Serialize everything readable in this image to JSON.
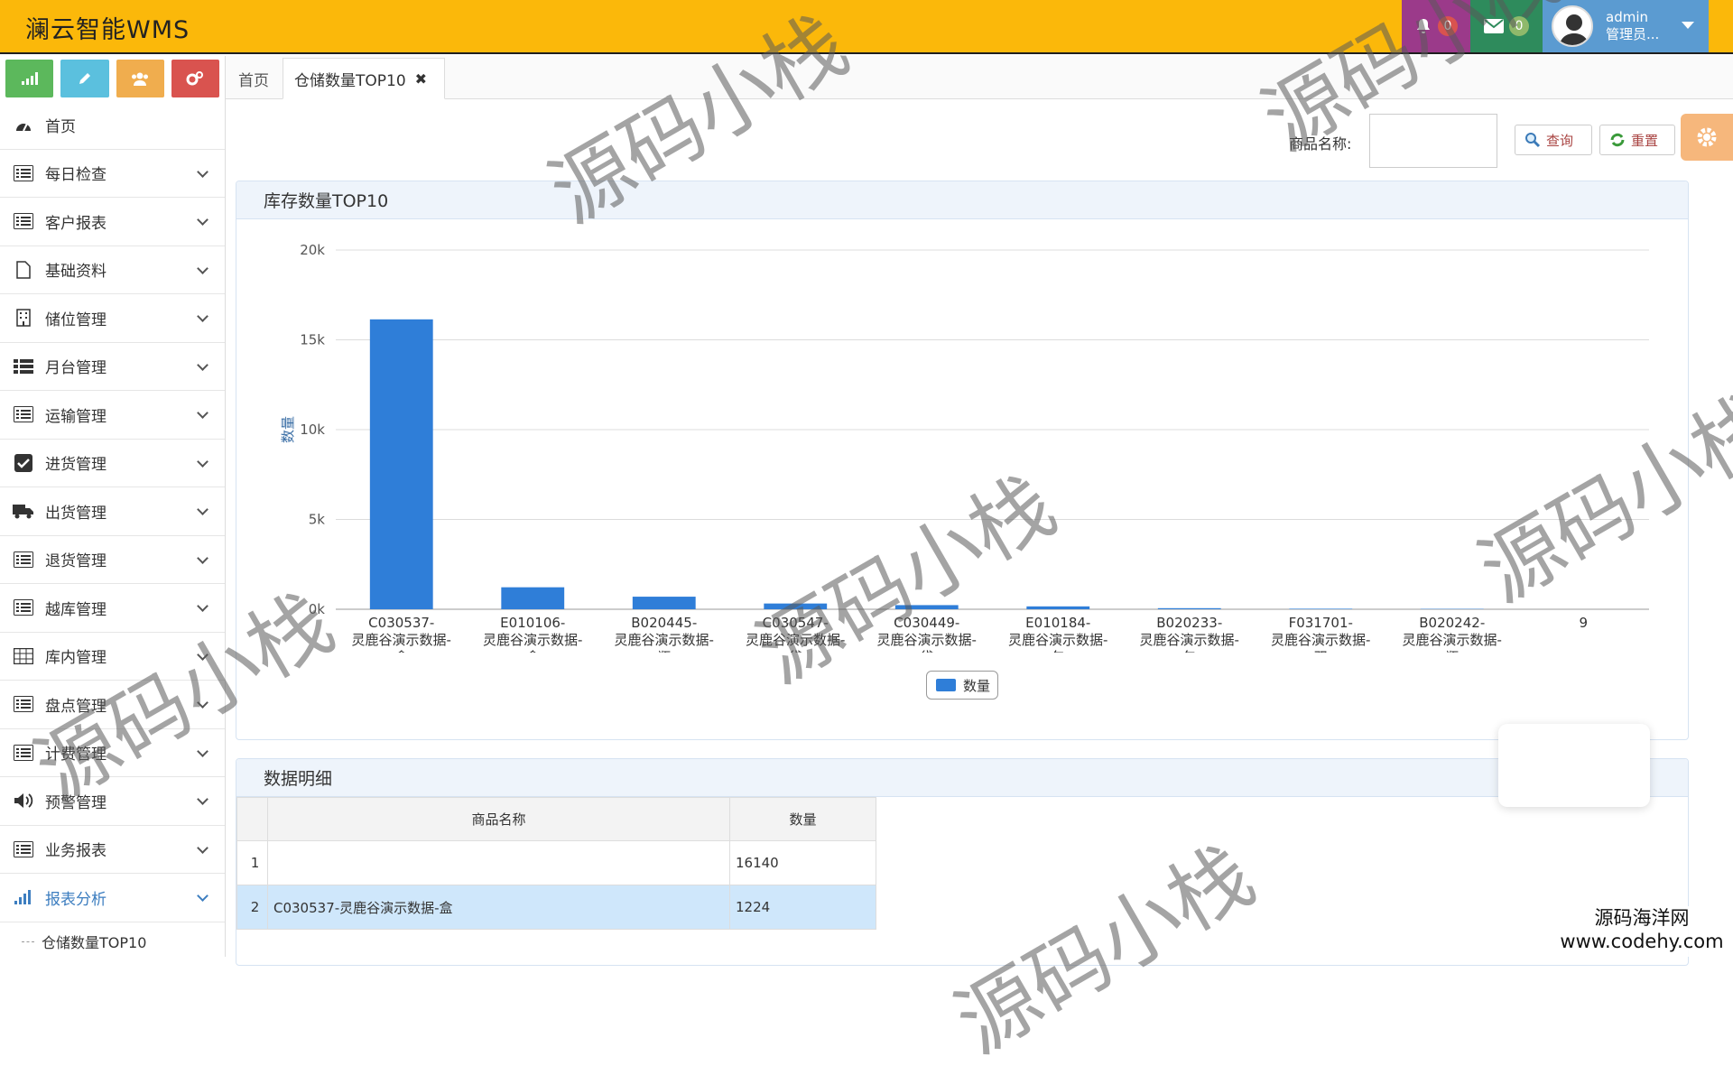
{
  "app": {
    "title": "澜云智能WMS"
  },
  "header": {
    "notifications_count": "0",
    "messages_count": "0",
    "user_name": "admin",
    "user_role": "管理员..."
  },
  "sidebar": {
    "items": [
      {
        "label": "首页",
        "icon": "dashboard-icon"
      },
      {
        "label": "每日检查",
        "icon": "list-icon"
      },
      {
        "label": "客户报表",
        "icon": "list-icon"
      },
      {
        "label": "基础资料",
        "icon": "file-icon"
      },
      {
        "label": "储位管理",
        "icon": "building-icon"
      },
      {
        "label": "月台管理",
        "icon": "th-list-icon"
      },
      {
        "label": "运输管理",
        "icon": "list-icon"
      },
      {
        "label": "进货管理",
        "icon": "check-square-icon"
      },
      {
        "label": "出货管理",
        "icon": "truck-icon"
      },
      {
        "label": "退货管理",
        "icon": "list-icon"
      },
      {
        "label": "越库管理",
        "icon": "list-icon"
      },
      {
        "label": "库内管理",
        "icon": "table-icon"
      },
      {
        "label": "盘点管理",
        "icon": "list-icon"
      },
      {
        "label": "计费管理",
        "icon": "list-icon"
      },
      {
        "label": "预警管理",
        "icon": "volume-icon"
      },
      {
        "label": "业务报表",
        "icon": "list-icon"
      },
      {
        "label": "报表分析",
        "icon": "signal-icon"
      }
    ],
    "sub_item": "仓储数量TOP10"
  },
  "tabs": {
    "home": "首页",
    "active": "仓储数量TOP10"
  },
  "search": {
    "label": "商品名称:",
    "value": "",
    "query_btn": "查询",
    "reset_btn": "重置"
  },
  "chart_panel": {
    "title": "库存数量TOP10"
  },
  "table_panel": {
    "title": "数据明细"
  },
  "colors": {
    "topbar": "#fbb80a",
    "bar": "#2f7ed8",
    "selected_row": "#cfe7fb"
  },
  "chart_data": {
    "type": "bar",
    "categories": [
      [
        "C030537-",
        "灵鹿谷演示数据-",
        "盒"
      ],
      [
        "E010106-",
        "灵鹿谷演示数据-",
        "盒"
      ],
      [
        "B020445-",
        "灵鹿谷演示数据-",
        "瓶"
      ],
      [
        "C030547-",
        "灵鹿谷演示数据-",
        "袋"
      ],
      [
        "C030449-",
        "灵鹿谷演示数据-",
        "袋"
      ],
      [
        "E010184-",
        "灵鹿谷演示数据-",
        "包"
      ],
      [
        "B020233-",
        "灵鹿谷演示数据-",
        "包"
      ],
      [
        "F031701-",
        "灵鹿谷演示数据-",
        "双"
      ],
      [
        "B020242-",
        "灵鹿谷演示数据-",
        "瓶"
      ],
      [
        "9"
      ]
    ],
    "series": [
      {
        "name": "数量",
        "values": [
          16140,
          1224,
          700,
          320,
          230,
          160,
          60,
          30,
          20,
          0
        ]
      }
    ],
    "ylabel": "数量",
    "ylim": [
      0,
      20000
    ],
    "yticks": [
      "0k",
      "5k",
      "10k",
      "15k",
      "20k"
    ],
    "grid": true,
    "legend_position": "bottom-center"
  },
  "table": {
    "headers": [
      "商品名称",
      "数量"
    ],
    "rows": [
      {
        "idx": "1",
        "name": "",
        "qty": "16140"
      },
      {
        "idx": "2",
        "name": "C030537-灵鹿谷演示数据-盒",
        "qty": "1224"
      }
    ]
  },
  "watermark": {
    "text": "源码小栈",
    "corner_line1": "源码海洋网",
    "corner_line2": "www.codehy.com"
  }
}
